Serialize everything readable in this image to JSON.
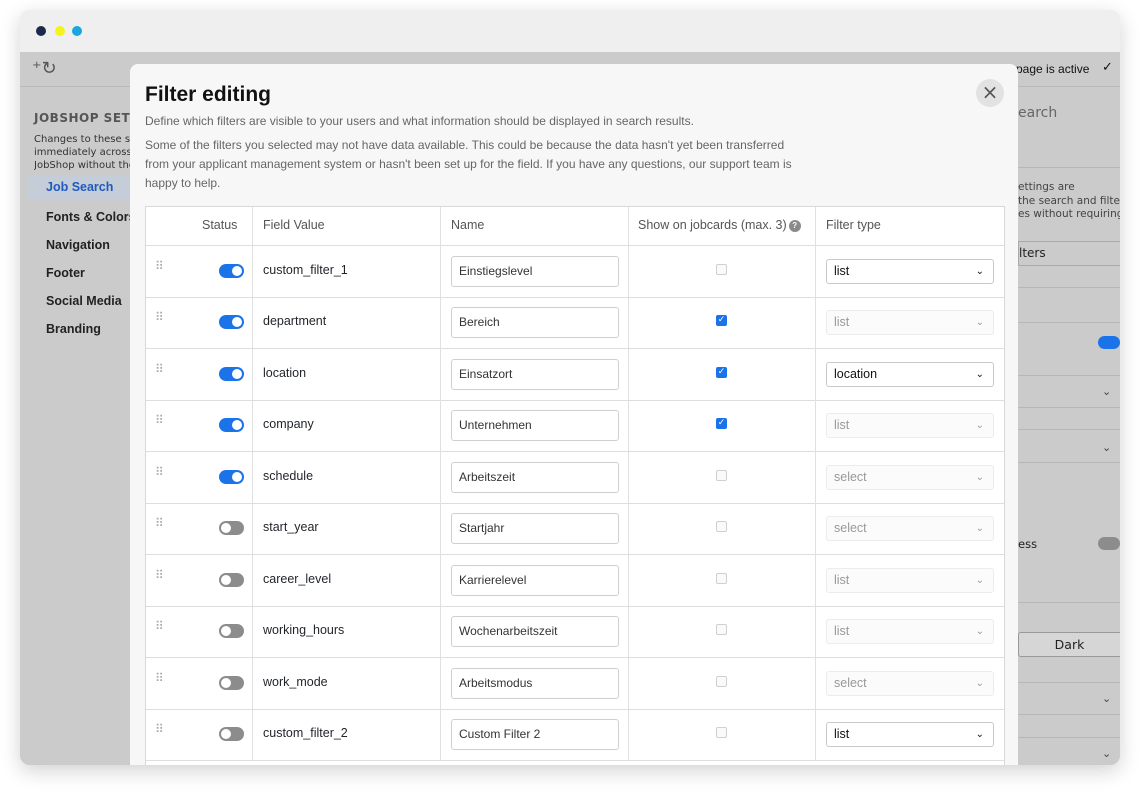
{
  "window": {
    "traffic_lights": [
      "#1b2a4a",
      "#f5f31a",
      "#19a6e0"
    ],
    "accent": "#1a73e8",
    "toggle_off": "#8c8c8c"
  },
  "topbar": {
    "logo_icon": "logo-icon",
    "status_text": "page is active",
    "status_icon": "✓"
  },
  "sidebar": {
    "title": "JOBSHOP SETTI",
    "description_lines": [
      "Changes to these set",
      "immediately across a",
      "JobShop without the"
    ],
    "items": [
      {
        "label": "Job Search",
        "active": true
      },
      {
        "label": "Fonts & Colors",
        "active": false
      },
      {
        "label": "Navigation",
        "active": false
      },
      {
        "label": "Footer",
        "active": false
      },
      {
        "label": "Social Media",
        "active": false
      },
      {
        "label": "Branding",
        "active": false
      }
    ]
  },
  "right_panel": {
    "search_fragment": "earch",
    "desc_lines": [
      "ettings are",
      " the search and filter",
      "es without requiring"
    ],
    "filters_fragment": "lters",
    "ess_fragment": "ess",
    "dark_label": "Dark"
  },
  "modal": {
    "title": "Filter editing",
    "intro": "Define which filters are visible to your users and what information should be displayed in search results.",
    "intro_lines": [
      "Some of the filters you selected may not have data available. This could be because the data hasn't yet been transferred",
      "from your applicant management system or hasn't been set up for the field. If you have any questions, our support team is",
      "happy to help."
    ],
    "close_icon": "×",
    "columns": {
      "status": "Status",
      "field_value": "Field Value",
      "name": "Name",
      "show_on_jobcards": "Show on jobcards (max. 3)",
      "help_icon": "?",
      "filter_type": "Filter type"
    },
    "rows": [
      {
        "enabled": true,
        "field": "custom_filter_1",
        "name": "Einstiegslevel",
        "show": false,
        "type": "list",
        "type_enabled": true
      },
      {
        "enabled": true,
        "field": "department",
        "name": "Bereich",
        "show": true,
        "type": "list",
        "type_enabled": false
      },
      {
        "enabled": true,
        "field": "location",
        "name": "Einsatzort",
        "show": true,
        "type": "location",
        "type_enabled": true
      },
      {
        "enabled": true,
        "field": "company",
        "name": "Unternehmen",
        "show": true,
        "type": "list",
        "type_enabled": false
      },
      {
        "enabled": true,
        "field": "schedule",
        "name": "Arbeitszeit",
        "show": false,
        "type": "select",
        "type_enabled": false
      },
      {
        "enabled": false,
        "field": "start_year",
        "name": "Startjahr",
        "show": false,
        "type": "select",
        "type_enabled": false
      },
      {
        "enabled": false,
        "field": "career_level",
        "name": "Karrierelevel",
        "show": false,
        "type": "list",
        "type_enabled": false
      },
      {
        "enabled": false,
        "field": "working_hours",
        "name": "Wochenarbeitszeit",
        "show": false,
        "type": "list",
        "type_enabled": false
      },
      {
        "enabled": false,
        "field": "work_mode",
        "name": "Arbeitsmodus",
        "show": false,
        "type": "select",
        "type_enabled": false
      },
      {
        "enabled": false,
        "field": "custom_filter_2",
        "name": "Custom Filter 2",
        "show": false,
        "type": "list",
        "type_enabled": true
      }
    ]
  }
}
